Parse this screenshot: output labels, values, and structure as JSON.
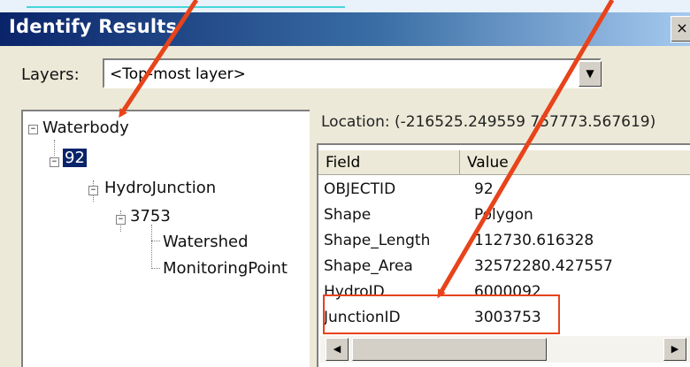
{
  "window": {
    "title": "Identify Results",
    "close_glyph": "×"
  },
  "layers": {
    "label": "Layers:",
    "selected": "<Top-most layer>"
  },
  "tree": {
    "nodes": [
      "Waterbody",
      "92",
      "HydroJunction",
      "3753",
      "Watershed",
      "MonitoringPoint"
    ],
    "expander_glyph": "−"
  },
  "location": "Location: (-216525.249559 757773.567619)",
  "table": {
    "columns": [
      "Field",
      "Value"
    ],
    "rows": [
      {
        "field": "OBJECTID",
        "value": "92"
      },
      {
        "field": "Shape",
        "value": "Polygon"
      },
      {
        "field": "Shape_Length",
        "value": "112730.616328"
      },
      {
        "field": "Shape_Area",
        "value": "32572280.427557"
      },
      {
        "field": "HydroID",
        "value": "6000092"
      },
      {
        "field": "JunctionID",
        "value": "3003753"
      }
    ]
  },
  "icons": {
    "combo": "dropdown-arrow-icon",
    "scroll_left": "scroll-left-arrow-icon",
    "scroll_right": "scroll-right-arrow-icon"
  },
  "colors": {
    "accent_arrow": "#e8431a",
    "title_bar": "#0a246a",
    "selection": "#0a246a"
  }
}
